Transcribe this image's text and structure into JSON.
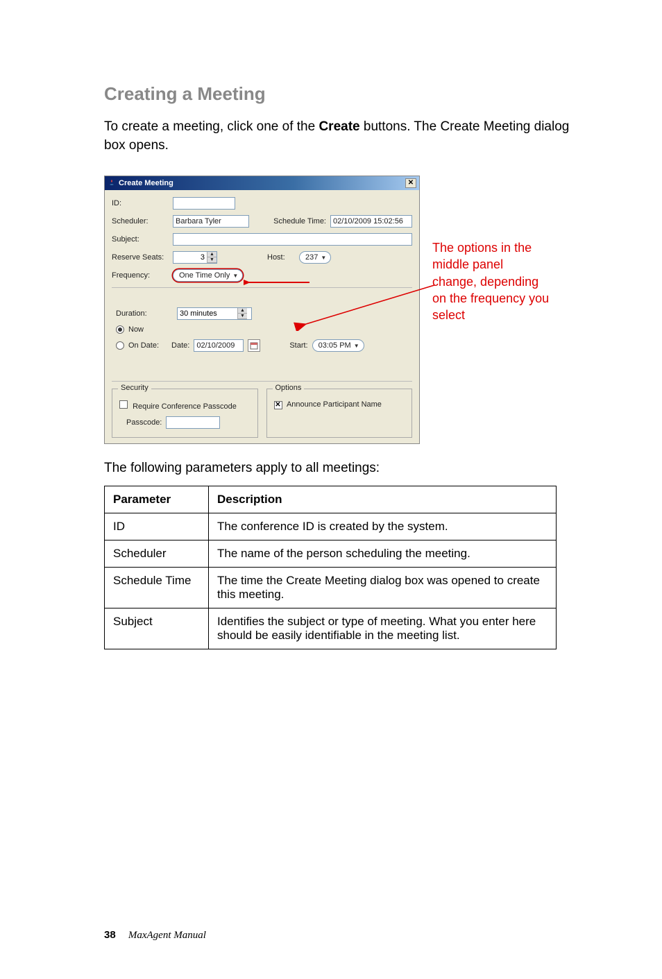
{
  "heading": "Creating a Meeting",
  "intro_pre": "To create a meeting, click one of the ",
  "intro_bold": "Create",
  "intro_post": " buttons. The Create Meeting dialog box opens.",
  "dialog": {
    "title": "Create Meeting",
    "close_glyph": "✕",
    "labels": {
      "id": "ID:",
      "scheduler": "Scheduler:",
      "schedule_time": "Schedule Time:",
      "subject": "Subject:",
      "reserve_seats": "Reserve Seats:",
      "host": "Host:",
      "frequency": "Frequency:",
      "duration": "Duration:",
      "now": "Now",
      "on_date": "On Date:",
      "date": "Date:",
      "start": "Start:"
    },
    "values": {
      "scheduler": "Barbara Tyler",
      "schedule_time": "02/10/2009 15:02:56",
      "reserve_seats": "3",
      "host": "237",
      "frequency": "One Time Only",
      "duration": "30 minutes",
      "date": "02/10/2009",
      "start": "03:05 PM"
    },
    "security": {
      "legend": "Security",
      "require_label": "Require Conference Passcode",
      "passcode_label": "Passcode:"
    },
    "options": {
      "legend": "Options",
      "announce_label": "Announce Participant Name",
      "announce_checked_glyph": "✕"
    }
  },
  "callout_text": "The options in the middle panel change, depending on the frequency you select",
  "table_caption": "The following parameters apply to all meetings:",
  "table": {
    "headers": {
      "param": "Parameter",
      "desc": "Description"
    },
    "rows": [
      {
        "param": "ID",
        "desc": "The conference ID is created by the system."
      },
      {
        "param": "Scheduler",
        "desc": "The name of the person scheduling the meeting."
      },
      {
        "param": "Schedule Time",
        "desc": "The time the Create Meeting dialog box was opened to create this meeting."
      },
      {
        "param": "Subject",
        "desc": "Identifies the subject or type of meeting. What you enter here should be easily identifiable in the meeting list."
      }
    ]
  },
  "footer": {
    "page": "38",
    "book": "MaxAgent Manual"
  }
}
